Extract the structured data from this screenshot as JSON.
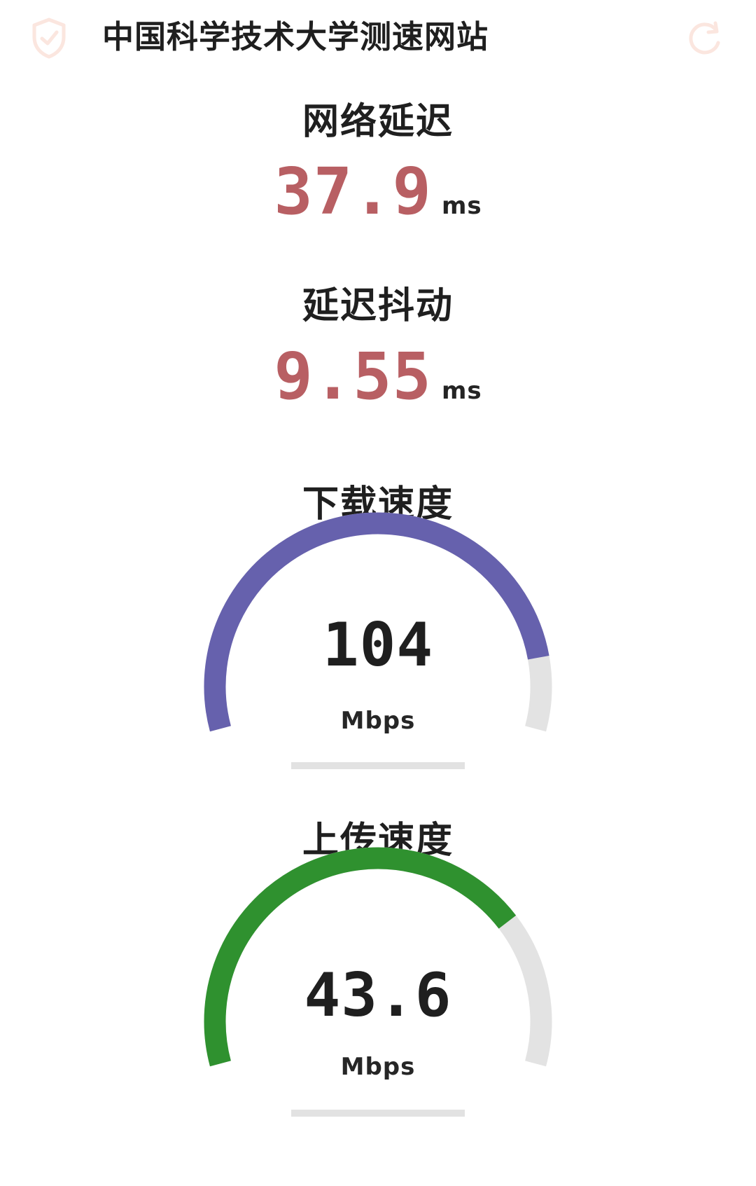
{
  "header": {
    "title": "中国科学技术大学测速网站",
    "left_icon": "shield-check-icon",
    "right_icon": "refresh-icon"
  },
  "metrics": {
    "latency": {
      "label": "网络延迟",
      "value": "37.9",
      "unit": "ms"
    },
    "jitter": {
      "label": "延迟抖动",
      "value": "9.55",
      "unit": "ms"
    }
  },
  "gauges": {
    "download": {
      "label": "下载速度",
      "value": "104",
      "unit": "Mbps",
      "progress": 0.88,
      "bar_progress": 0,
      "color": "#6661ad",
      "track_color": "#e3e3e3"
    },
    "upload": {
      "label": "上传速度",
      "value": "43.6",
      "unit": "Mbps",
      "progress": 0.75,
      "bar_progress": 0,
      "color": "#2f912f",
      "track_color": "#e3e3e3"
    }
  },
  "colors": {
    "metric_value": "#b85f63",
    "icon_faint": "#fbe6df"
  }
}
